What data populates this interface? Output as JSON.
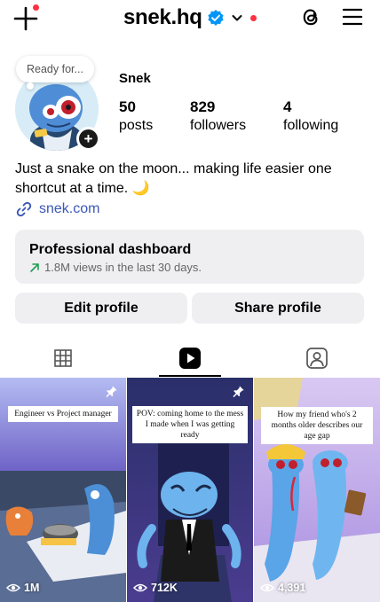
{
  "header": {
    "username": "snek.hq",
    "create_icon": "plus-icon",
    "verified_icon": "verified-badge-icon",
    "switch_icon": "chevron-down-icon",
    "threads_icon": "threads-icon",
    "menu_icon": "hamburger-menu-icon",
    "notification_color": "#ff3040",
    "verified_color": "#0095f6"
  },
  "profile": {
    "note": "Ready for...",
    "display_name": "Snek",
    "stats": [
      {
        "value": "50",
        "label": "posts"
      },
      {
        "value": "829",
        "label": "followers"
      },
      {
        "value": "4",
        "label": "following"
      }
    ],
    "bio": "Just a snake on the moon... making life easier one shortcut at a time. 🌙",
    "link": "snek.com",
    "link_color": "#3b57b8"
  },
  "dashboard": {
    "title": "Professional dashboard",
    "subtitle": "1.8M views in the last 30 days.",
    "trend_icon": "arrow-up-right-icon",
    "trend_color": "#1f9d55"
  },
  "actions": {
    "edit_label": "Edit profile",
    "share_label": "Share profile"
  },
  "tabs": [
    {
      "icon": "grid-icon",
      "active": false
    },
    {
      "icon": "reels-icon",
      "active": true
    },
    {
      "icon": "tagged-icon",
      "active": false
    }
  ],
  "reels": [
    {
      "caption": "Engineer vs Project manager",
      "views": "1M",
      "pinned": true
    },
    {
      "caption": "POV: coming home to the mess I made when I was getting ready",
      "views": "712K",
      "pinned": true
    },
    {
      "caption": "How my friend who's 2 months older describes our age gap",
      "views": "4,391",
      "pinned": false
    }
  ]
}
